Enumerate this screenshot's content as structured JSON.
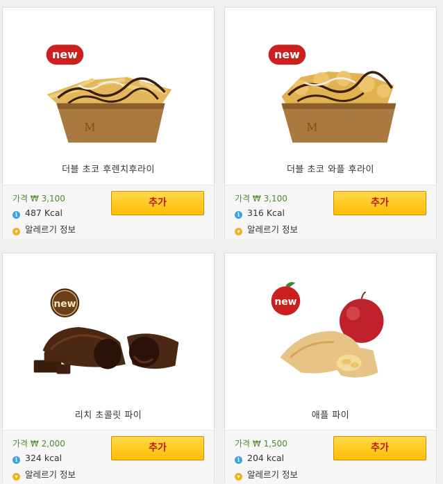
{
  "products": [
    {
      "name": "더블 초코 후렌치후라이",
      "badge": "new",
      "price": "가격 ₩ 3,100",
      "kcal": "487 Kcal",
      "allergy": "알레르기 정보",
      "add_label": "추가"
    },
    {
      "name": "더블 초코 와플 후라이",
      "badge": "new",
      "price": "가격 ₩ 3,100",
      "kcal": "316 Kcal",
      "allergy": "알레르기 정보",
      "add_label": "추가"
    },
    {
      "name": "리치 초콜릿 파이",
      "badge": "new",
      "price": "가격 ₩ 2,000",
      "kcal": "324 kcal",
      "allergy": "알레르기 정보",
      "add_label": "추가"
    },
    {
      "name": "애플 파이",
      "badge": "new",
      "price": "가격 ₩ 1,500",
      "kcal": "204 kcal",
      "allergy": "알레르기 정보",
      "add_label": "추가"
    }
  ],
  "colors": {
    "badge_red": "#cc1f1f",
    "price_green": "#4d8a2a",
    "button_yellow": "#ffc61a",
    "button_text": "#c0160c",
    "info_icon": "#3ea3e0",
    "allergy_icon": "#f0b322"
  }
}
